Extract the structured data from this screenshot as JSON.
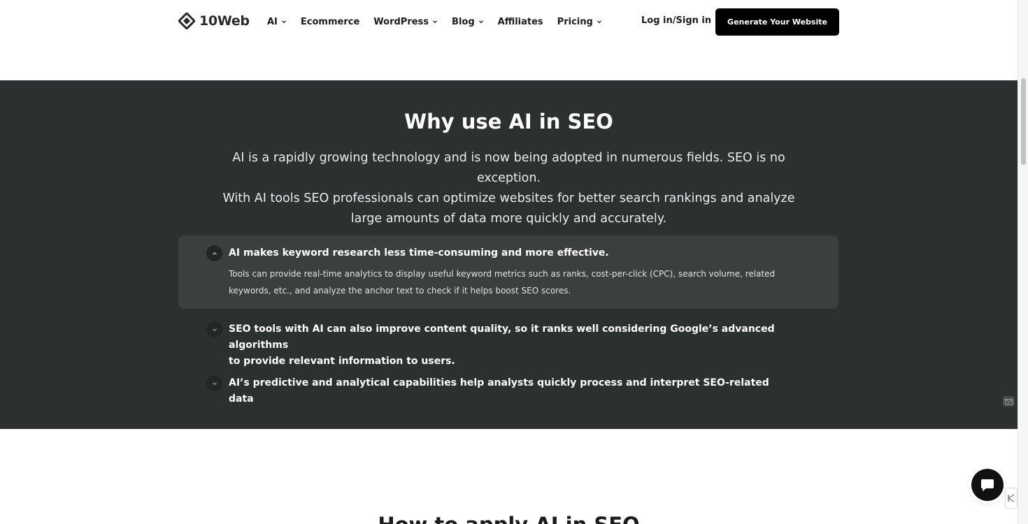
{
  "header": {
    "logo_text": "10Web",
    "nav": [
      {
        "label": "AI",
        "has_dropdown": true
      },
      {
        "label": "Ecommerce",
        "has_dropdown": false
      },
      {
        "label": "WordPress",
        "has_dropdown": true
      },
      {
        "label": "Blog",
        "has_dropdown": true
      },
      {
        "label": "Affiliates",
        "has_dropdown": false
      },
      {
        "label": "Pricing",
        "has_dropdown": true
      }
    ],
    "login_label": "Log in/Sign in",
    "cta_label": "Generate Your Website"
  },
  "why_section": {
    "title": "Why use AI in SEO",
    "description_lines": [
      "AI is a rapidly growing technology and is now being adopted in numerous fields. SEO is no exception.",
      "With AI tools SEO professionals can optimize websites for better search rankings and analyze",
      "large amounts of data more quickly and accurately."
    ],
    "accordion": [
      {
        "title": "AI makes keyword research less time-consuming and more effective.",
        "body_lines": [
          "Tools can provide real-time analytics to display useful keyword metrics such as ranks, cost-per-click (CPC), search volume, related",
          "keywords, etc., and analyze the anchor text to check if it helps boost SEO scores."
        ],
        "expanded": true
      },
      {
        "title_lines": [
          "SEO tools with AI can also improve content quality, so it ranks well considering Google’s advanced algorithms",
          "to provide relevant information to users."
        ],
        "expanded": false
      },
      {
        "title": "AI’s predictive and analytical capabilities help analysts quickly process and interpret SEO-related data",
        "expanded": false
      }
    ]
  },
  "next_section": {
    "title": "How to apply AI in SEO"
  },
  "colors": {
    "dark_section_bg": "#2c3030",
    "accordion_open_bg": "#3b3f3f",
    "cta_bg": "#000000",
    "text_light": "#ffffff"
  }
}
